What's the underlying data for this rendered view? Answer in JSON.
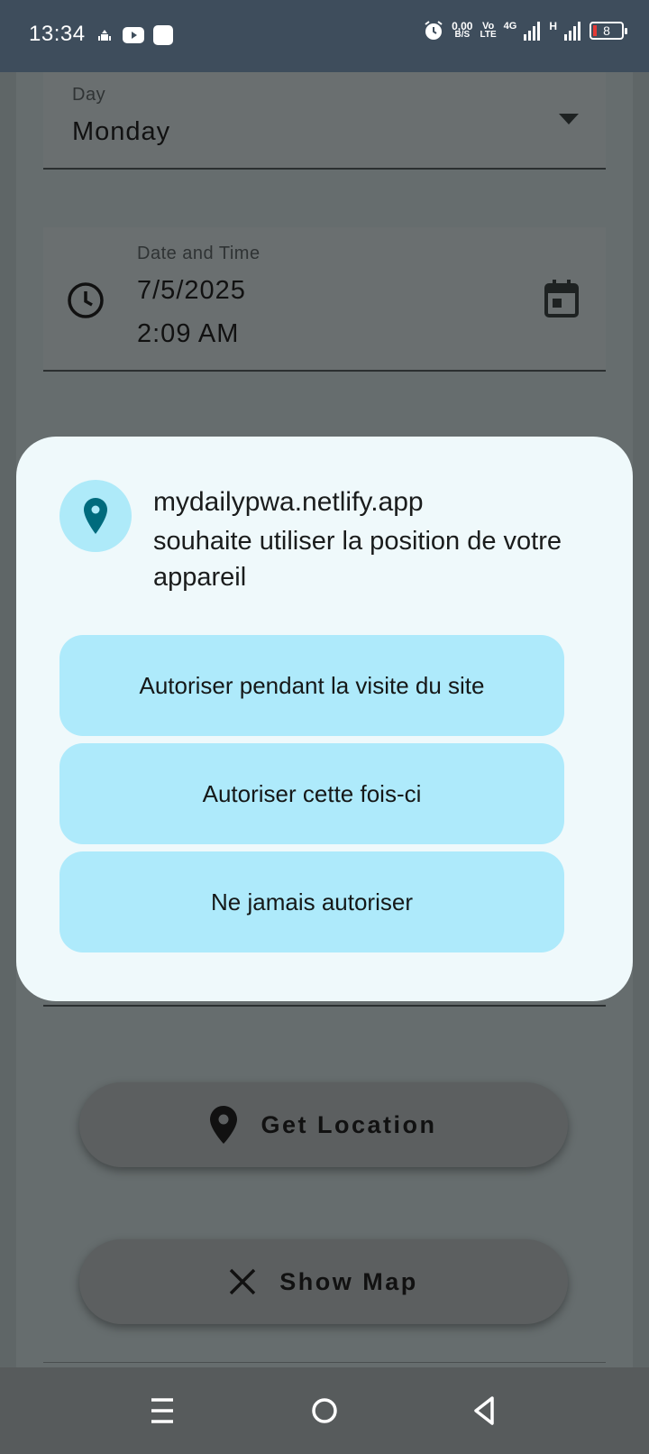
{
  "status_bar": {
    "time": "13:34",
    "net_speed_value": "0,00",
    "net_speed_unit": "B/S",
    "volte_top": "Vo",
    "volte_bottom": "LTE",
    "net_type": "4G",
    "net_type2": "H",
    "battery": "8",
    "battery_low_color": "#e53935"
  },
  "form": {
    "day_label": "Day",
    "day_value": "Monday",
    "datetime_label": "Date and Time",
    "date_value": "7/5/2025",
    "time_value": "2:09 AM"
  },
  "buttons": {
    "get_location": "Get Location",
    "show_map": "Show Map"
  },
  "dialog": {
    "host": "mydailypwa.netlify.app",
    "message": "souhaite utiliser la position de votre appareil",
    "allow_while_visiting": "Autoriser pendant la visite du site",
    "allow_once": "Autoriser cette fois-ci",
    "never_allow": "Ne jamais autoriser",
    "accent_color": "#006b7d"
  },
  "nav_bar": {
    "icons": [
      "menu-icon",
      "home-circle-icon",
      "back-triangle-icon"
    ]
  }
}
